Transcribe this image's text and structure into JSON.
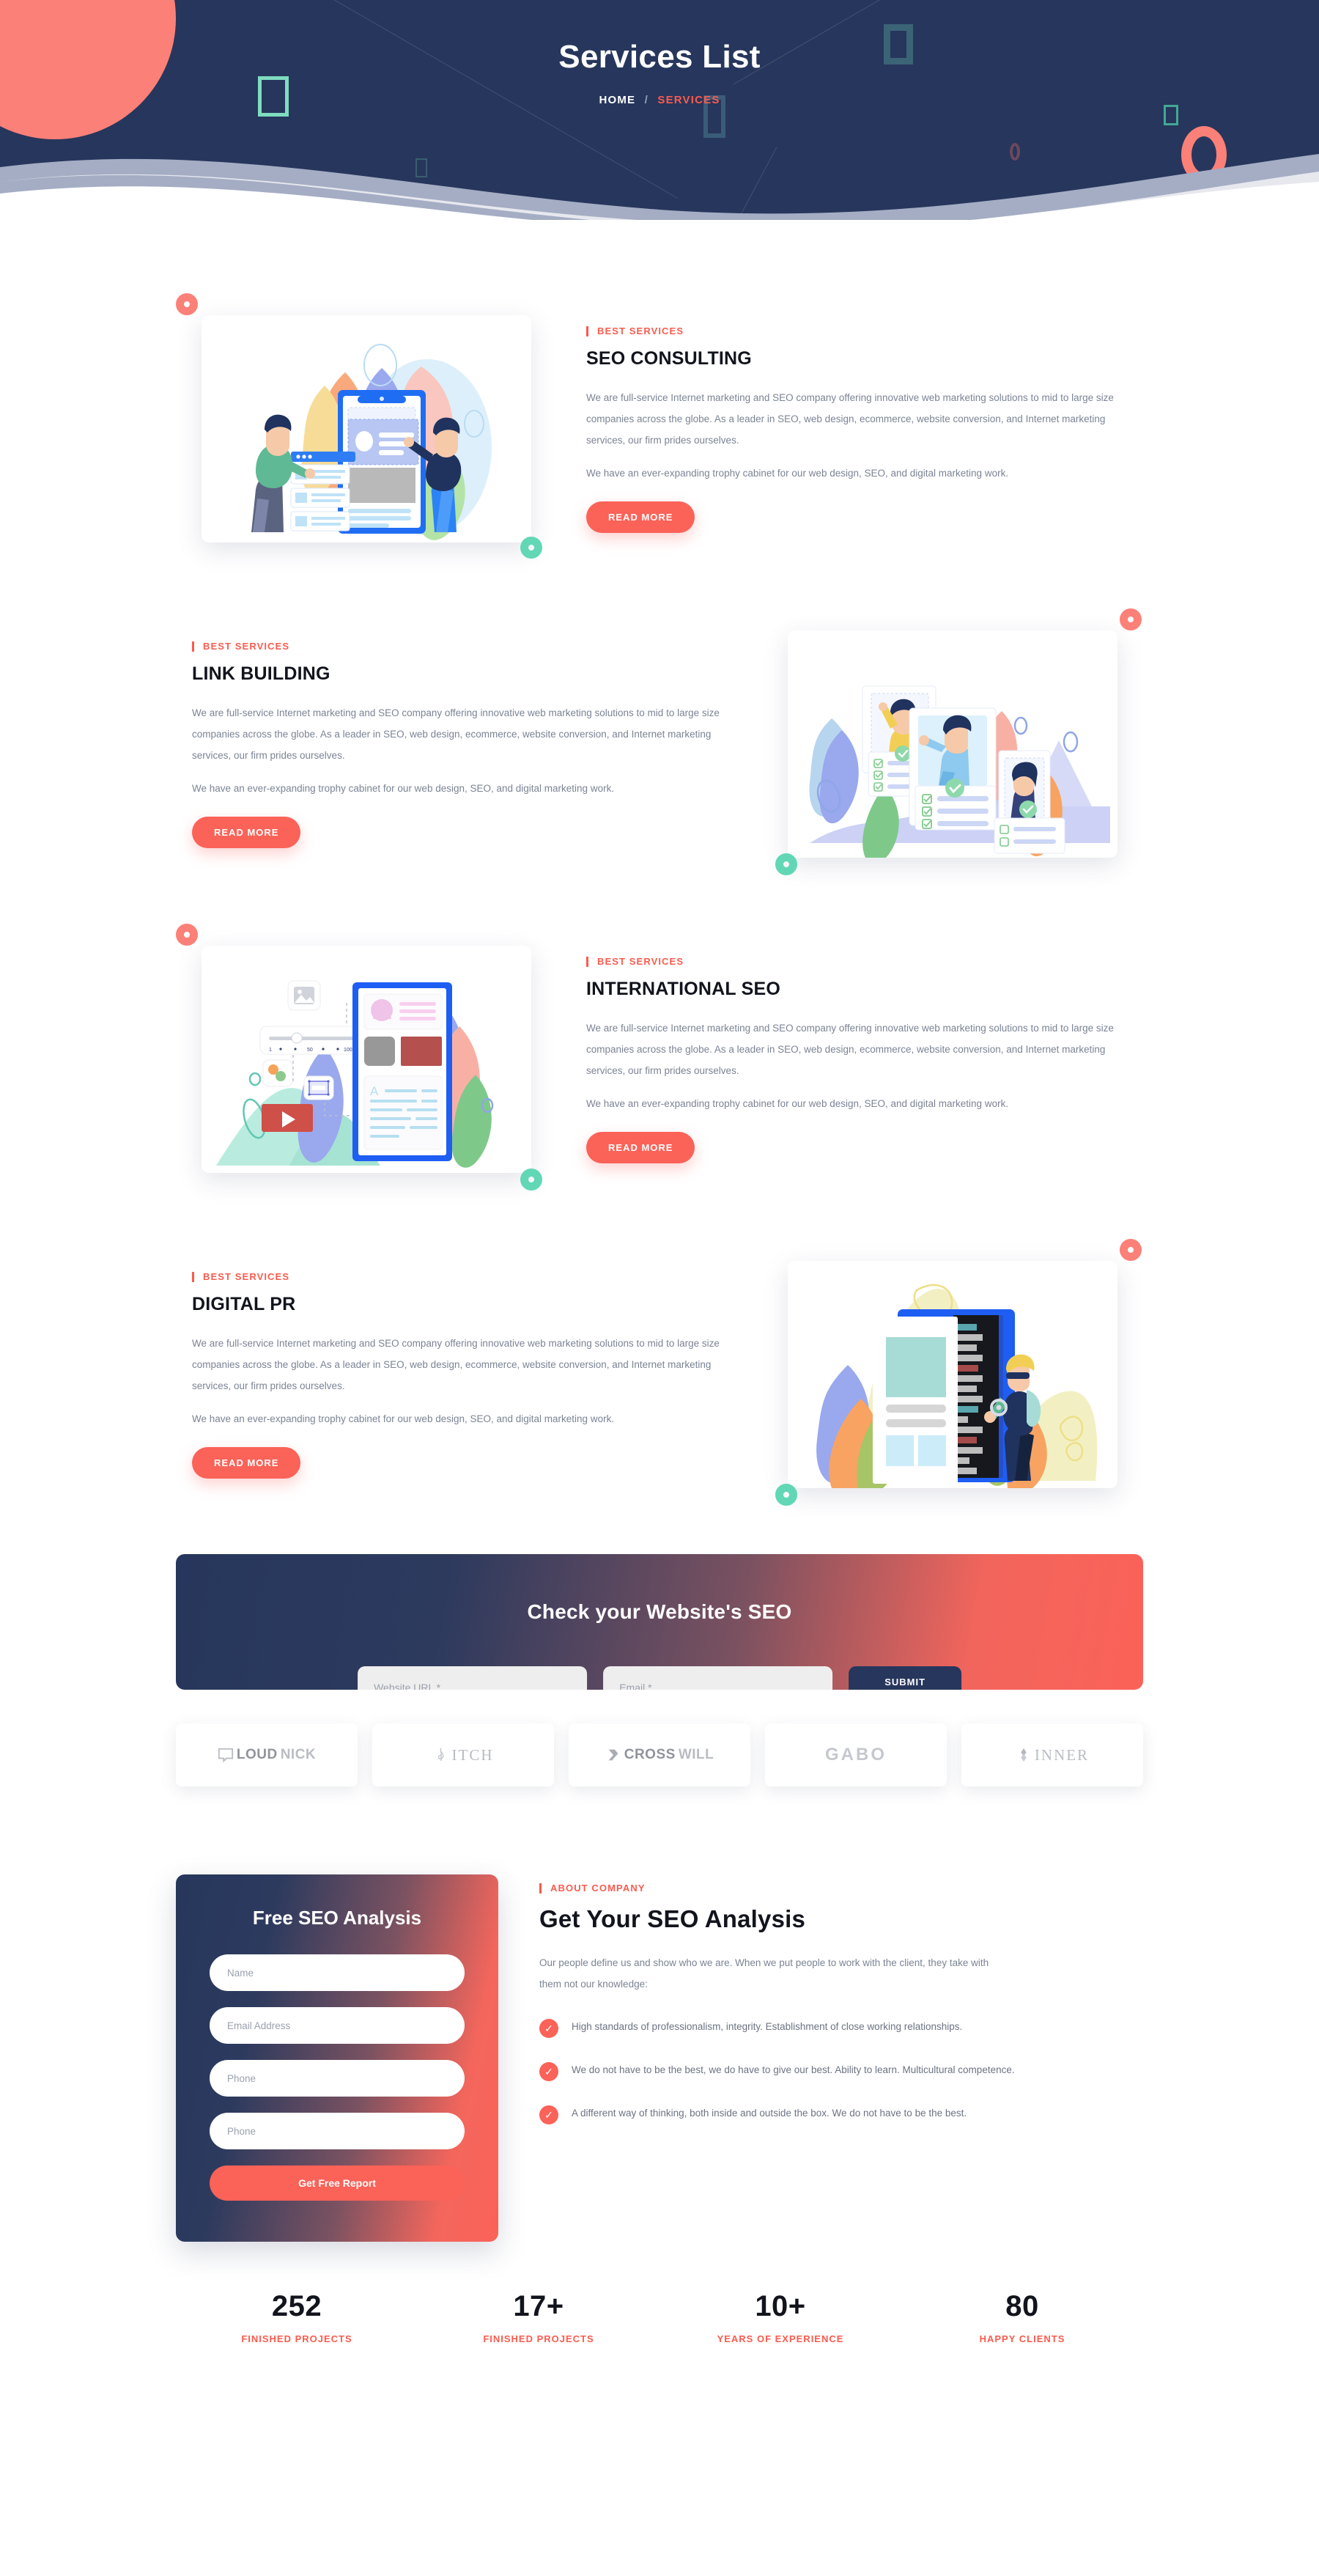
{
  "hero": {
    "title": "Services List",
    "breadcrumb_home": "HOME",
    "breadcrumb_sep": "/",
    "breadcrumb_current": "SERVICES",
    "bg_color": "#27365c",
    "accent_color": "#fb5b4e"
  },
  "services": [
    {
      "eyebrow": "BEST SERVICES",
      "title": "SEO CONSULTING",
      "paragraph1": "We are full-service Internet marketing and SEO company offering innovative web marketing solutions to mid to large size companies across the globe. As a leader in SEO, web design, ecommerce, website conversion, and Internet marketing services, our firm prides ourselves.",
      "paragraph2": "We have an ever-expanding trophy cabinet for our web design, SEO, and digital marketing work.",
      "button": "READ MORE",
      "illustration": "seo-consulting-illustration"
    },
    {
      "eyebrow": "BEST SERVICES",
      "title": "LINK BUILDING",
      "paragraph1": "We are full-service Internet marketing and SEO company offering innovative web marketing solutions to mid to large size companies across the globe. As a leader in SEO, web design, ecommerce, website conversion, and Internet marketing services, our firm prides ourselves.",
      "paragraph2": "We have an ever-expanding trophy cabinet for our web design, SEO, and digital marketing work.",
      "button": "READ MORE",
      "illustration": "link-building-illustration"
    },
    {
      "eyebrow": "BEST SERVICES",
      "title": "INTERNATIONAL SEO",
      "paragraph1": "We are full-service Internet marketing and SEO company offering innovative web marketing solutions to mid to large size companies across the globe. As a leader in SEO, web design, ecommerce, website conversion, and Internet marketing services, our firm prides ourselves.",
      "paragraph2": "We have an ever-expanding trophy cabinet for our web design, SEO, and digital marketing work.",
      "button": "READ MORE",
      "illustration": "international-seo-illustration"
    },
    {
      "eyebrow": "BEST SERVICES",
      "title": "DIGITAL PR",
      "paragraph1": "We are full-service Internet marketing and SEO company offering innovative web marketing solutions to mid to large size companies across the globe. As a leader in SEO, web design, ecommerce, website conversion, and Internet marketing services, our firm prides ourselves.",
      "paragraph2": "We have an ever-expanding trophy cabinet for our web design, SEO, and digital marketing work.",
      "button": "READ MORE",
      "illustration": "digital-pr-illustration"
    }
  ],
  "seo_banner": {
    "title": "Check your Website's SEO",
    "url_placeholder": "Website URL *",
    "email_placeholder": "Email *",
    "submit_label": "SUBMIT NOW"
  },
  "clients": [
    {
      "name_a": "LOUD",
      "name_b": "NICK",
      "style": "bracket"
    },
    {
      "name_a": "",
      "name_b": "ITCH",
      "style": "pitch"
    },
    {
      "name_a": "CROSS",
      "name_b": "WILL",
      "style": "chevron"
    },
    {
      "name_a": "GABO",
      "name_b": "",
      "style": "blocky"
    },
    {
      "name_a": "",
      "name_b": "INNER",
      "style": "diamond"
    }
  ],
  "analysis_form": {
    "title": "Free SEO Analysis",
    "name_placeholder": "Name",
    "email_placeholder": "Email Address",
    "phone_placeholder": "Phone",
    "phone2_placeholder": "Phone",
    "submit_label": "Get Free Report"
  },
  "about": {
    "eyebrow": "ABOUT COMPANY",
    "title": "Get Your SEO Analysis",
    "paragraph": "Our people define us and show who we are. When we put people to work with the client, they take with them not our knowledge:",
    "check_icon": "✓",
    "points": [
      "High standards of professionalism, integrity. Establishment of close working relationships.",
      "We do not have to be the best, we do have to give our best. Ability to learn. Multicultural competence.",
      "A different way of thinking, both inside and outside the box. We do not have to be the best."
    ]
  },
  "counters": [
    {
      "number": "252",
      "label": "FINISHED PROJECTS"
    },
    {
      "number": "17+",
      "label": "FINISHED PROJECTS"
    },
    {
      "number": "10+",
      "label": "YEARS OF EXPERIENCE"
    },
    {
      "number": "80",
      "label": "HAPPY CLIENTS"
    }
  ]
}
